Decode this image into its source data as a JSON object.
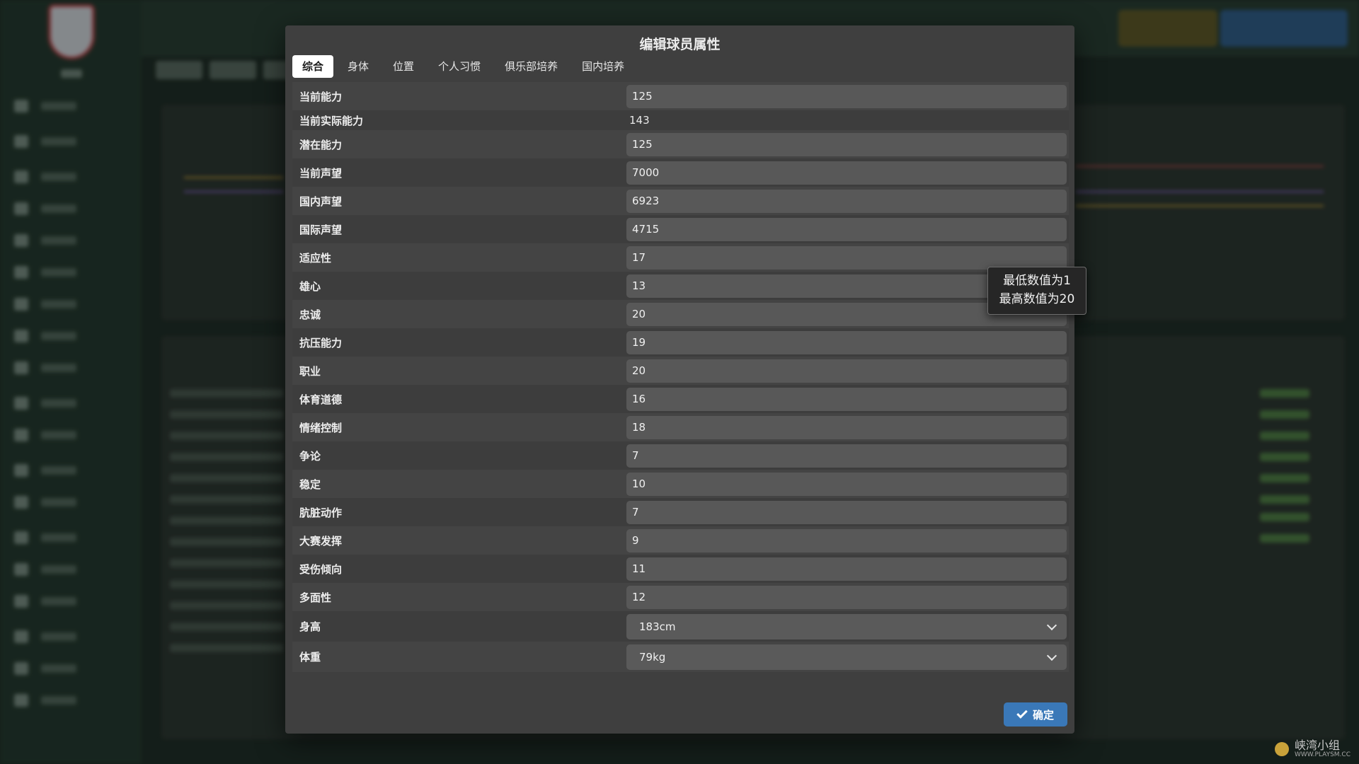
{
  "modal": {
    "title": "编辑球员属性",
    "tabs": [
      {
        "label": "综合",
        "active": true
      },
      {
        "label": "身体",
        "active": false
      },
      {
        "label": "位置",
        "active": false
      },
      {
        "label": "个人习惯",
        "active": false
      },
      {
        "label": "俱乐部培养",
        "active": false
      },
      {
        "label": "国内培养",
        "active": false
      }
    ],
    "fields": {
      "current_ability": {
        "label": "当前能力",
        "value": "125"
      },
      "actual_ability": {
        "label": "当前实际能力",
        "value": "143"
      },
      "potential_ability": {
        "label": "潜在能力",
        "value": "125"
      },
      "current_reputation": {
        "label": "当前声望",
        "value": "7000"
      },
      "home_reputation": {
        "label": "国内声望",
        "value": "6923"
      },
      "world_reputation": {
        "label": "国际声望",
        "value": "4715"
      },
      "adaptability": {
        "label": "适应性",
        "value": "17"
      },
      "ambition": {
        "label": "雄心",
        "value": "13"
      },
      "loyalty": {
        "label": "忠诚",
        "value": "20"
      },
      "pressure": {
        "label": "抗压能力",
        "value": "19"
      },
      "professionalism": {
        "label": "职业",
        "value": "20"
      },
      "sportsmanship": {
        "label": "体育道德",
        "value": "16"
      },
      "temperament": {
        "label": "情绪控制",
        "value": "18"
      },
      "controversy": {
        "label": "争论",
        "value": "7"
      },
      "consistency": {
        "label": "稳定",
        "value": "10"
      },
      "dirtiness": {
        "label": "肮脏动作",
        "value": "7"
      },
      "important_matches": {
        "label": "大赛发挥",
        "value": "9"
      },
      "injury_proneness": {
        "label": "受伤倾向",
        "value": "11"
      },
      "versatility": {
        "label": "多面性",
        "value": "12"
      },
      "height": {
        "label": "身高",
        "value": "183cm"
      },
      "weight": {
        "label": "体重",
        "value": "79kg"
      }
    },
    "tooltip": {
      "line1": "最低数值为1",
      "line2": "最高数值为20"
    },
    "confirm_label": "确定"
  },
  "watermark": {
    "title": "峡湾小组",
    "url": "WWW.PLAYSM.CC"
  },
  "icons": [
    "check-icon",
    "chevron-down-icon",
    "club-crest-icon"
  ]
}
